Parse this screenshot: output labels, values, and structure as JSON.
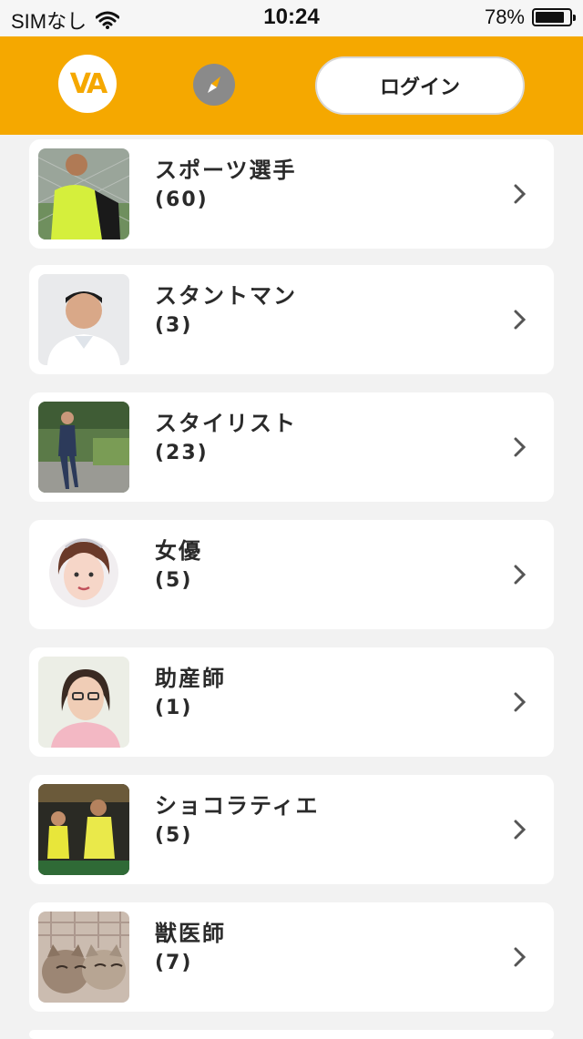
{
  "status_bar": {
    "carrier": "SIMなし",
    "time": "10:24",
    "battery": "78%",
    "battery_level": 0.78
  },
  "header": {
    "logo_text": "VA",
    "login_label": "ログイン",
    "accent_color": "#f5a800"
  },
  "categories": [
    {
      "name": "スポーツ選手",
      "count": "(60)"
    },
    {
      "name": "スタントマン",
      "count": "(3)"
    },
    {
      "name": "スタイリスト",
      "count": "(23)"
    },
    {
      "name": "女優",
      "count": "(5)"
    },
    {
      "name": "助産師",
      "count": "(1)"
    },
    {
      "name": "ショコラティエ",
      "count": "(5)"
    },
    {
      "name": "獣医師",
      "count": "(7)"
    }
  ]
}
